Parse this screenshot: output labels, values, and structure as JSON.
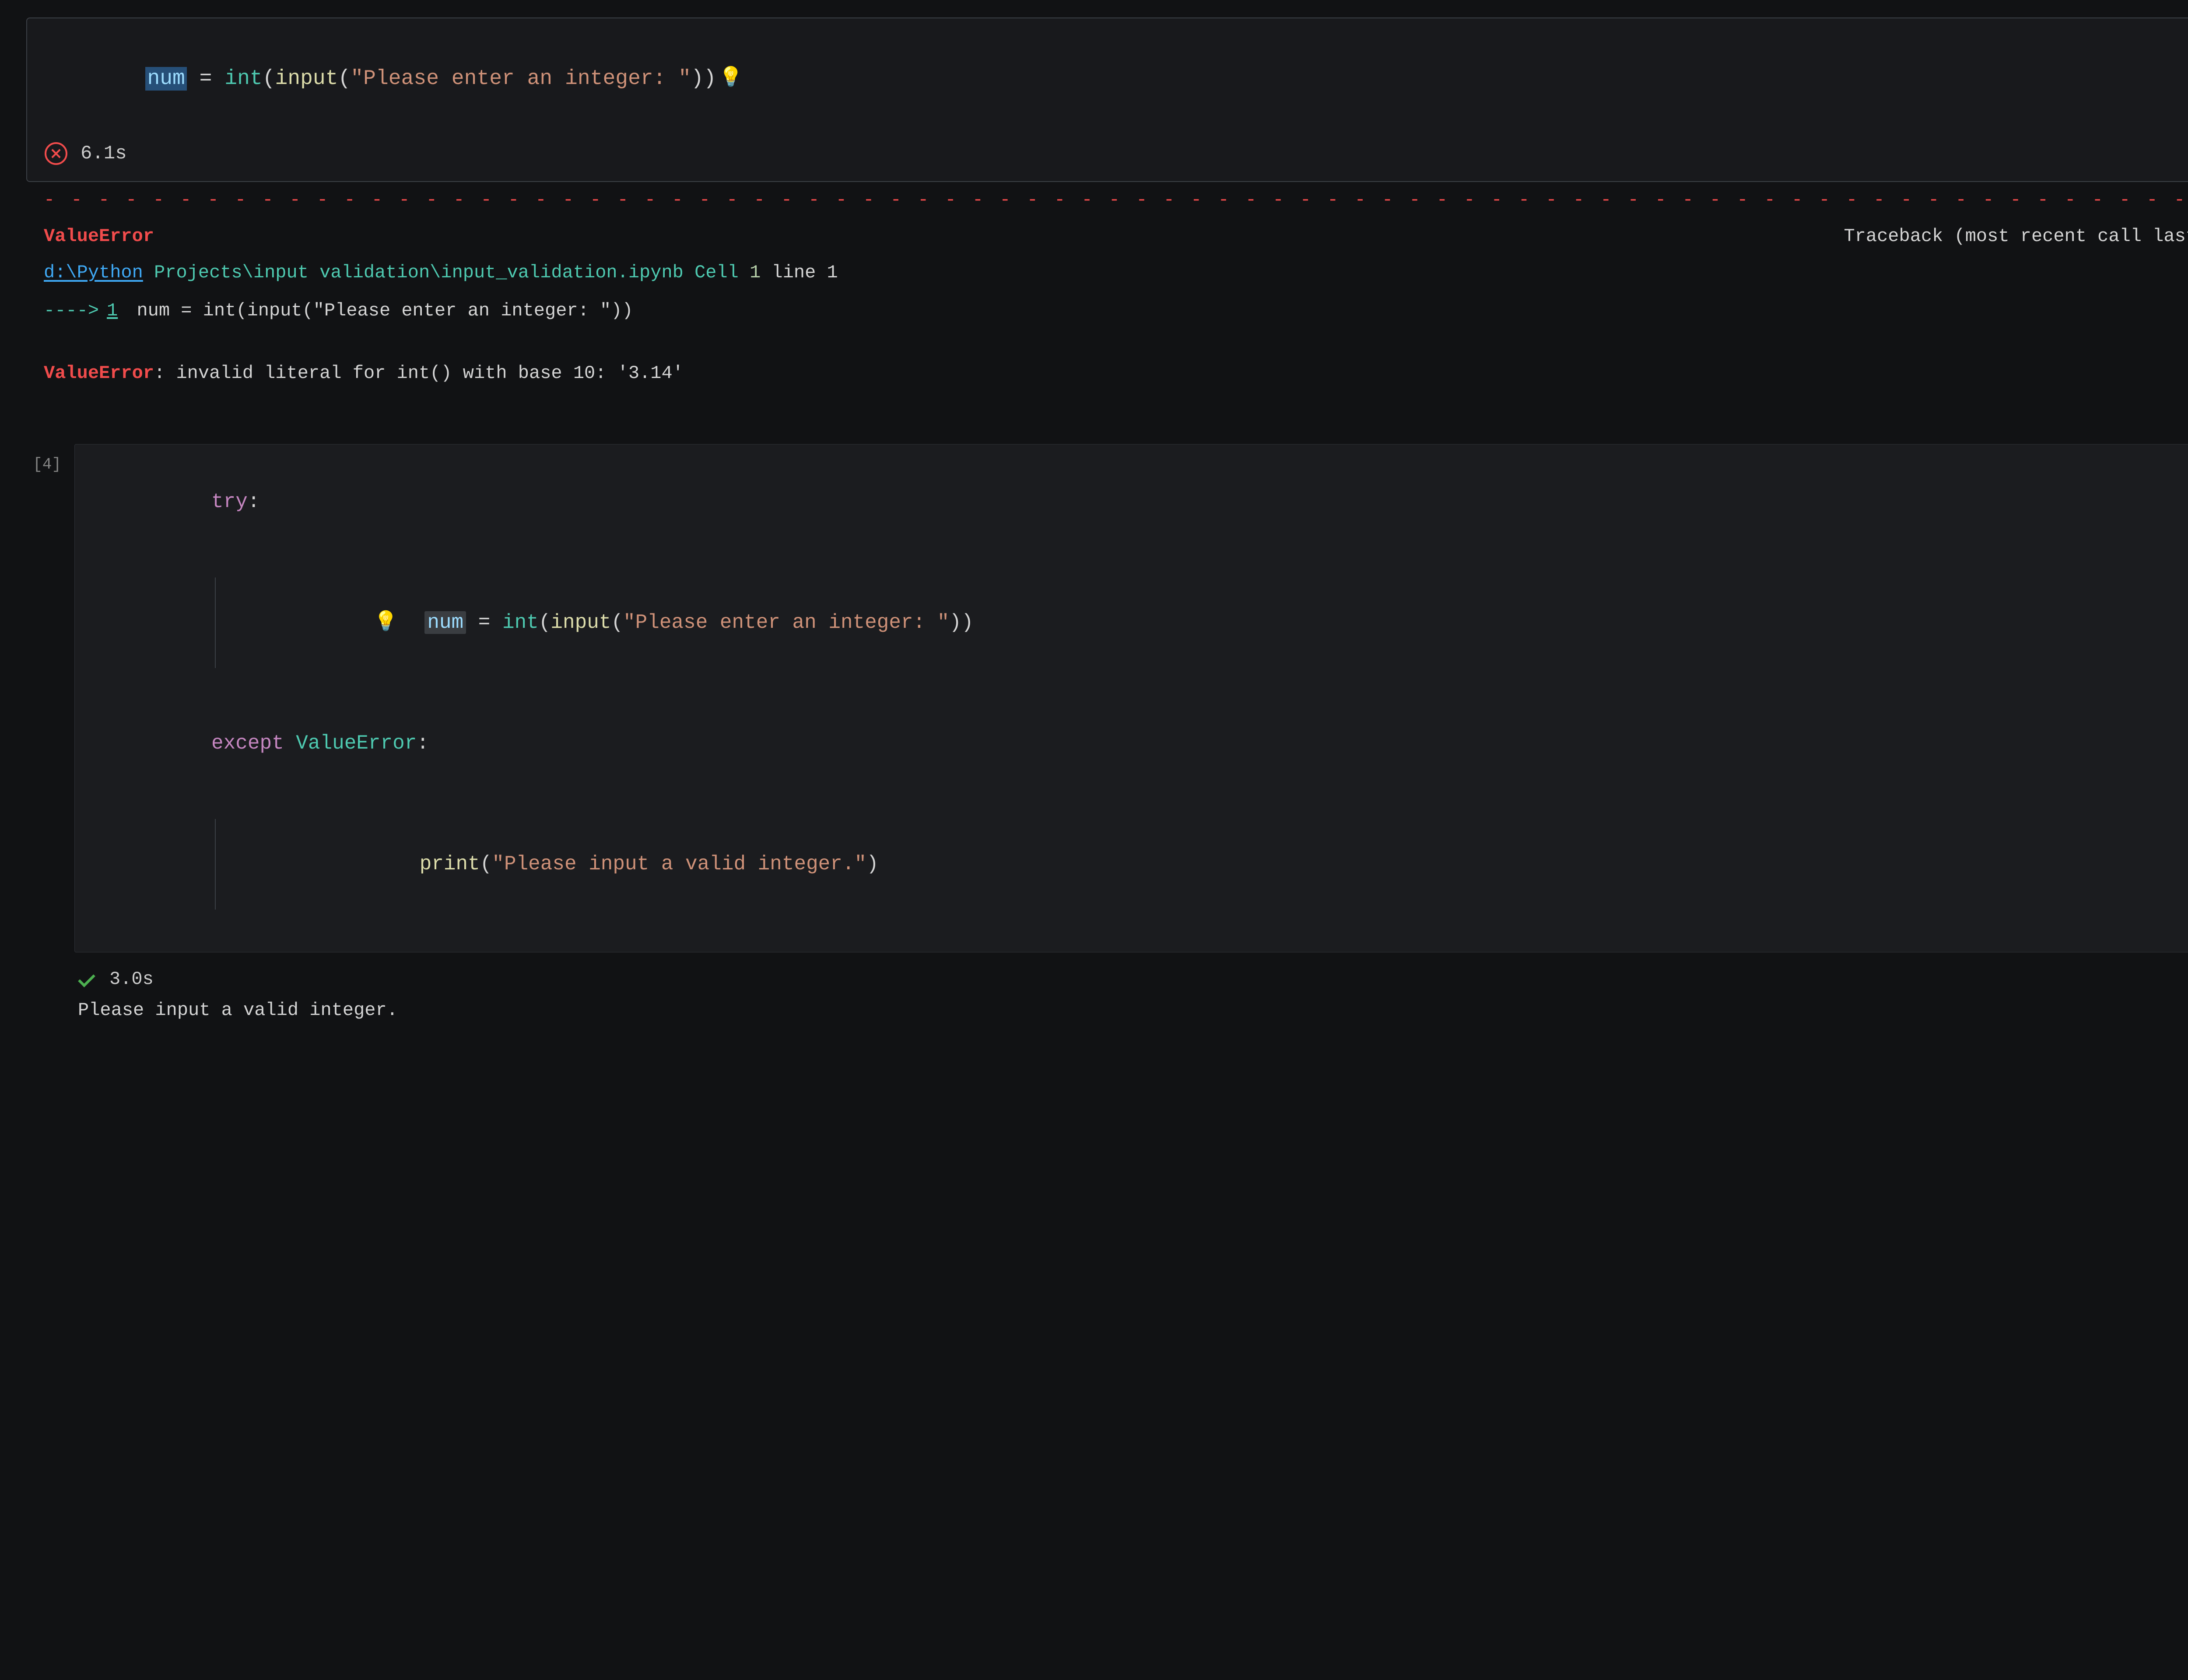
{
  "cell1": {
    "code": {
      "var": "num",
      "assign": " = ",
      "func_int": "int",
      "func_input": "input",
      "prompt": "\"Please enter an integer: \""
    },
    "status_time": "6.1s",
    "error": {
      "dashes": "- - - - - - - - - - - - - - - - - - - - - - - - - - - - - - - - - - - - - - - - - - - - - - - - - - - - - - - - - - - - - - - - - - - - - - - - - - - - - - - - - - - -",
      "name": "ValueError",
      "traceback_label": "Traceback (most recent call last",
      "path_link": "d:\\Python",
      "path_rest_pre": " Projects\\input validation\\",
      "path_file": "input_validation.ipynb",
      "cell_word": " Cell ",
      "cell_num": "1",
      "line_word": " line ",
      "line_num": "1",
      "arrow": "---->",
      "arrow_lineno": "1",
      "arrow_code_plain": " num = int(input(\"Please enter an integer: \"))",
      "final_name": "ValueError",
      "final_colon": ": ",
      "final_msg": "invalid literal for int() with base 10: '3.14'"
    }
  },
  "cell2": {
    "exec_count": "[4]",
    "code": {
      "kw_try": "try",
      "colon": ":",
      "var": "num",
      "assign": " = ",
      "func_int": "int",
      "func_input": "input",
      "prompt": "\"Please enter an integer: \"",
      "kw_except": "except",
      "exc_type": "ValueError",
      "func_print": "print",
      "print_msg": "\"Please input a valid integer.\""
    },
    "status_time": "3.0s",
    "output_text": "Please input a valid integer."
  }
}
